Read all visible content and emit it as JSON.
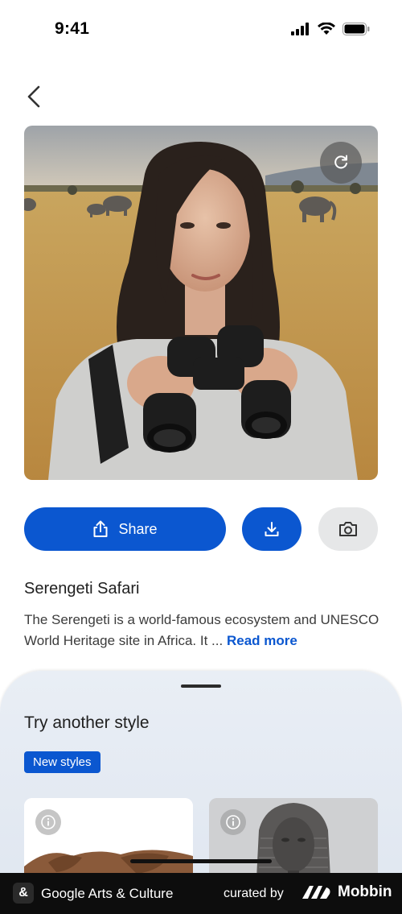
{
  "status_bar": {
    "time": "9:41"
  },
  "artwork": {
    "title": "Serengeti Safari",
    "description": "The Serengeti is a world-famous ecosystem and UNESCO World Heritage site in Africa. It ...",
    "read_more": "Read more"
  },
  "actions": {
    "share_label": "Share"
  },
  "styles_sheet": {
    "title": "Try another style",
    "badge": "New styles"
  },
  "footer": {
    "logo_glyph": "&",
    "app_name": "Google Arts & Culture",
    "curated_by": "curated by",
    "brand": "Mobbin"
  },
  "colors": {
    "accent": "#0b57d0",
    "secondary_button": "#e6e7e8",
    "sheet_background": "#e9eef5",
    "footer_background": "#0d0d0d"
  },
  "icons": [
    "back-arrow-icon",
    "refresh-icon",
    "share-icon",
    "download-icon",
    "camera-icon",
    "info-icon",
    "signal-icon",
    "wifi-icon",
    "battery-icon"
  ]
}
